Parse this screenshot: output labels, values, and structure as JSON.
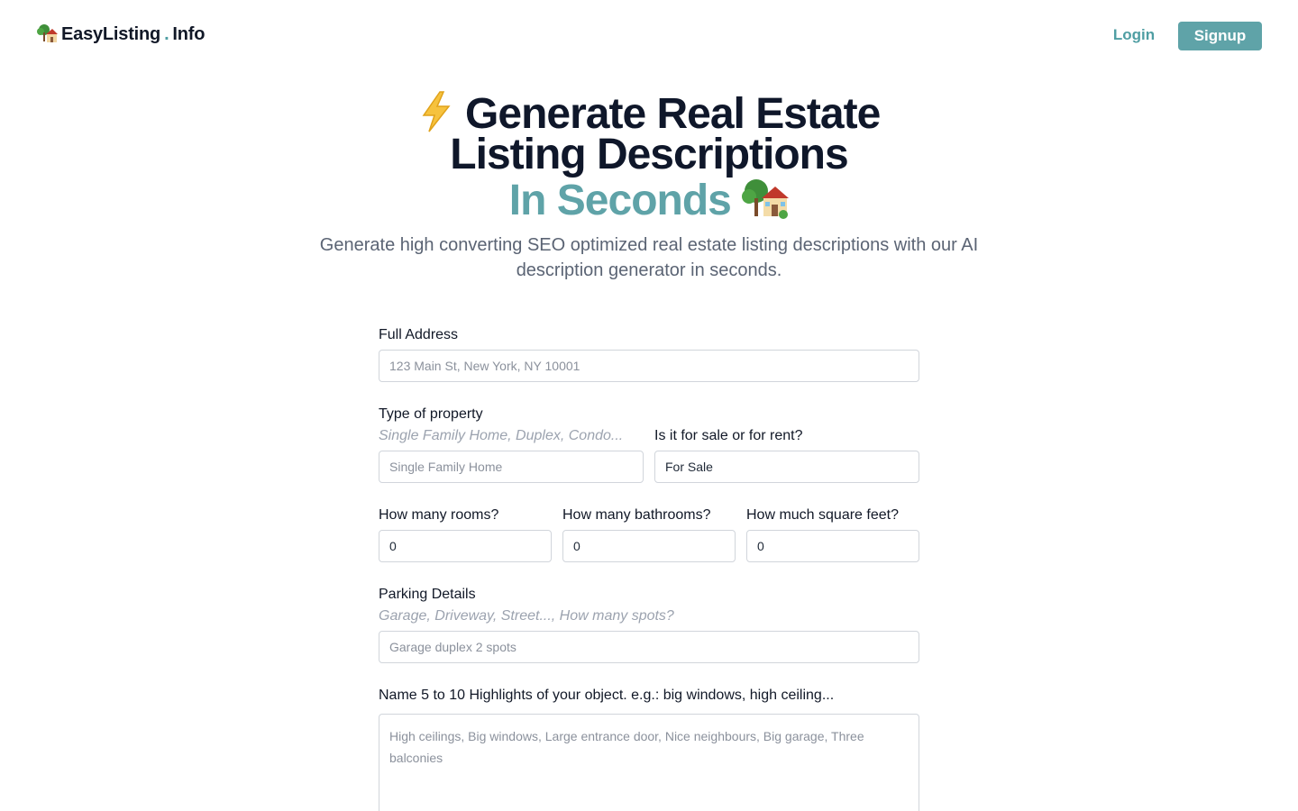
{
  "header": {
    "logo_name": "EasyListing",
    "logo_dot": ".",
    "logo_tld": "Info",
    "logo_icon": "tree-house-icon",
    "login_label": "Login",
    "signup_label": "Signup"
  },
  "hero": {
    "title_line1": "Generate Real Estate",
    "title_line2": "Listing Descriptions",
    "title_line3": "In Seconds",
    "lightning_icon": "lightning-icon",
    "house_icon": "house-with-garden-icon",
    "subtitle": "Generate high converting SEO optimized real estate listing descriptions with our AI description generator in seconds."
  },
  "form": {
    "address": {
      "label": "Full Address",
      "placeholder": "123 Main St, New York, NY 10001",
      "value": ""
    },
    "property_type": {
      "label": "Type of property",
      "hint": "Single Family Home, Duplex, Condo...",
      "placeholder": "Single Family Home",
      "value": ""
    },
    "sale_or_rent": {
      "label": "Is it for sale or for rent?",
      "value": "For Sale"
    },
    "rooms": {
      "label": "How many rooms?",
      "value": "0"
    },
    "bathrooms": {
      "label": "How many bathrooms?",
      "value": "0"
    },
    "square_feet": {
      "label": "How much square feet?",
      "value": "0"
    },
    "parking": {
      "label": "Parking Details",
      "hint": "Garage, Driveway, Street..., How many spots?",
      "placeholder": "Garage duplex 2 spots",
      "value": ""
    },
    "highlights": {
      "label": "Name 5 to 10 Highlights of your object. e.g.: big windows, high ceiling...",
      "placeholder": "High ceilings, Big windows, Large entrance door, Nice neighbours, Big garage, Three balconies",
      "value": ""
    }
  },
  "colors": {
    "accent": "#5fa3a8",
    "title": "#0f172a",
    "subtitle": "#5b6474",
    "hint": "#9ca3af",
    "border": "#d1d5db"
  }
}
